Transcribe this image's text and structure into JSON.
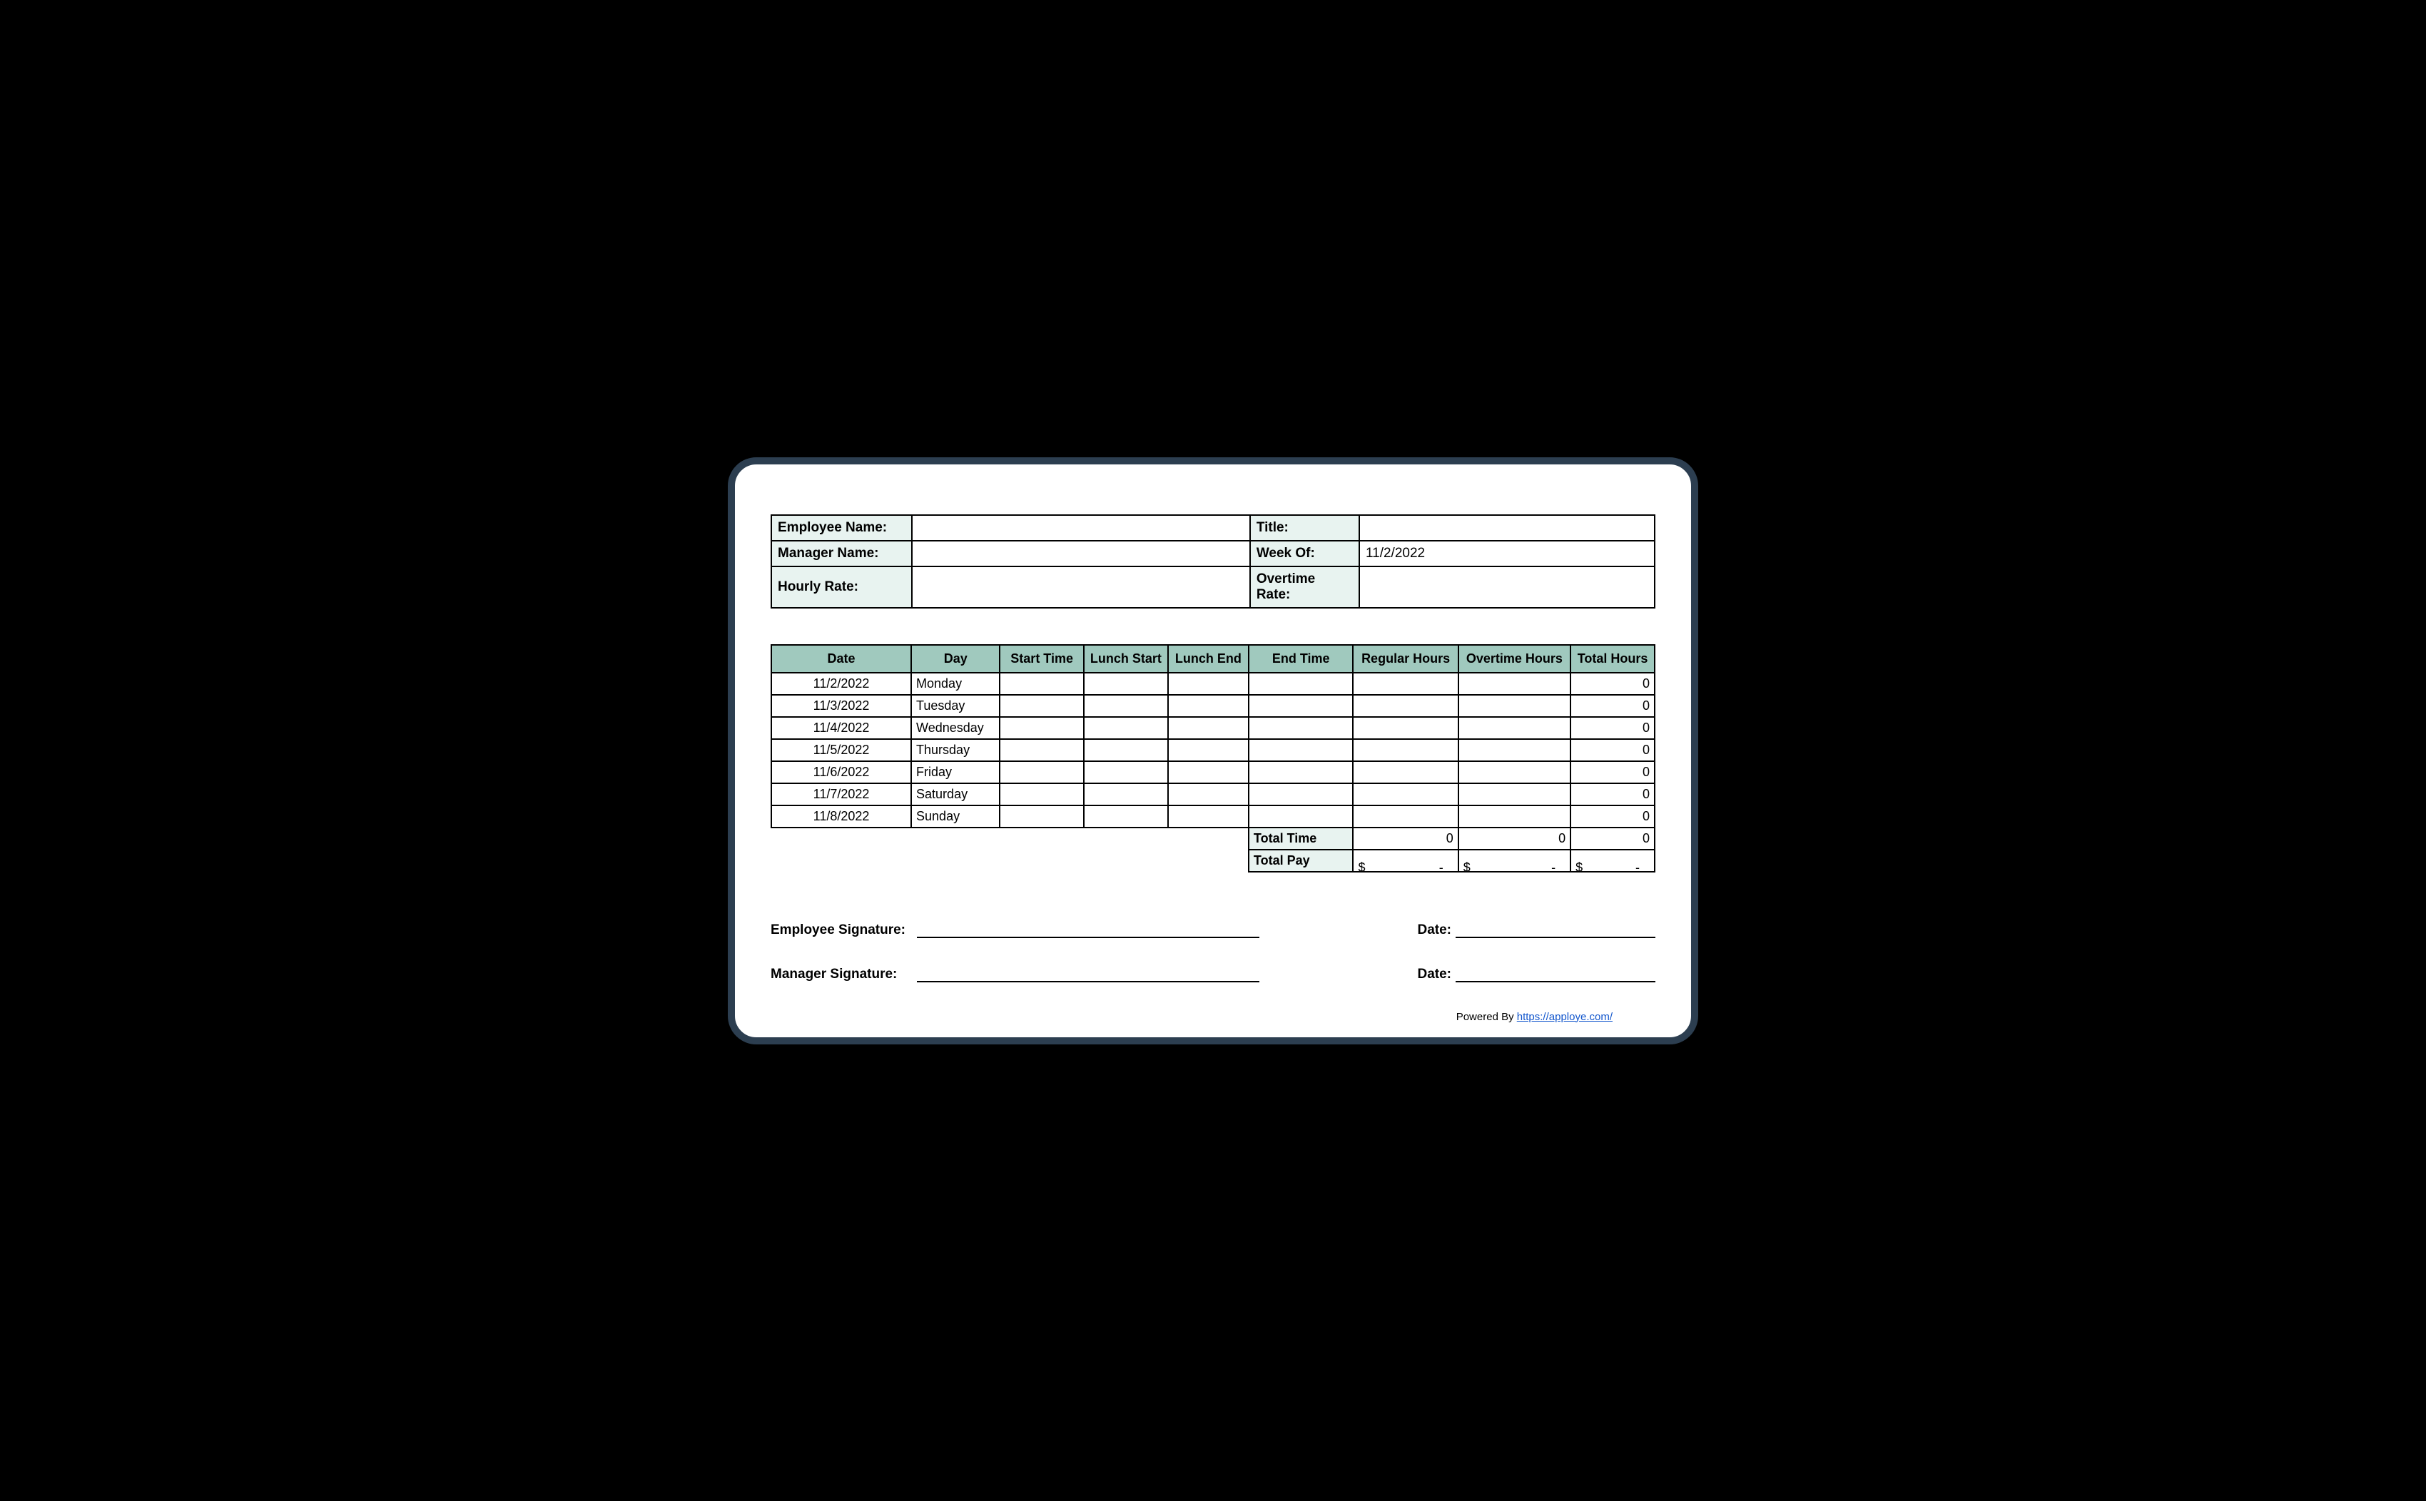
{
  "info": {
    "employee_name_label": "Employee Name:",
    "employee_name_value": "",
    "title_label": "Title:",
    "title_value": "",
    "manager_name_label": "Manager Name:",
    "manager_name_value": "",
    "week_of_label": "Week Of:",
    "week_of_value": "11/2/2022",
    "hourly_rate_label": "Hourly Rate:",
    "hourly_rate_value": "",
    "overtime_rate_label": "Overtime Rate:",
    "overtime_rate_value": ""
  },
  "headers": {
    "date": "Date",
    "day": "Day",
    "start": "Start Time",
    "lunch_start": "Lunch Start",
    "lunch_end": "Lunch End",
    "end": "End Time",
    "regular": "Regular Hours",
    "overtime": "Overtime Hours",
    "total": "Total Hours"
  },
  "rows": [
    {
      "date": "11/2/2022",
      "day": "Monday",
      "start": "",
      "lstart": "",
      "lend": "",
      "end": "",
      "reg": "",
      "ot": "",
      "total": "0"
    },
    {
      "date": "11/3/2022",
      "day": "Tuesday",
      "start": "",
      "lstart": "",
      "lend": "",
      "end": "",
      "reg": "",
      "ot": "",
      "total": "0"
    },
    {
      "date": "11/4/2022",
      "day": "Wednesday",
      "start": "",
      "lstart": "",
      "lend": "",
      "end": "",
      "reg": "",
      "ot": "",
      "total": "0"
    },
    {
      "date": "11/5/2022",
      "day": "Thursday",
      "start": "",
      "lstart": "",
      "lend": "",
      "end": "",
      "reg": "",
      "ot": "",
      "total": "0"
    },
    {
      "date": "11/6/2022",
      "day": "Friday",
      "start": "",
      "lstart": "",
      "lend": "",
      "end": "",
      "reg": "",
      "ot": "",
      "total": "0"
    },
    {
      "date": "11/7/2022",
      "day": "Saturday",
      "start": "",
      "lstart": "",
      "lend": "",
      "end": "",
      "reg": "",
      "ot": "",
      "total": "0"
    },
    {
      "date": "11/8/2022",
      "day": "Sunday",
      "start": "",
      "lstart": "",
      "lend": "",
      "end": "",
      "reg": "",
      "ot": "",
      "total": "0"
    }
  ],
  "summary": {
    "total_time_label": "Total Time",
    "total_time_reg": "0",
    "total_time_ot": "0",
    "total_time_total": "0",
    "total_pay_label": "Total Pay",
    "pay_currency": "$",
    "pay_dash": "-"
  },
  "signatures": {
    "employee_label": "Employee Signature:",
    "manager_label": "Manager Signature:",
    "date_label": "Date:"
  },
  "footer": {
    "powered_text": "Powered By ",
    "link_text": "https://apploye.com/"
  }
}
